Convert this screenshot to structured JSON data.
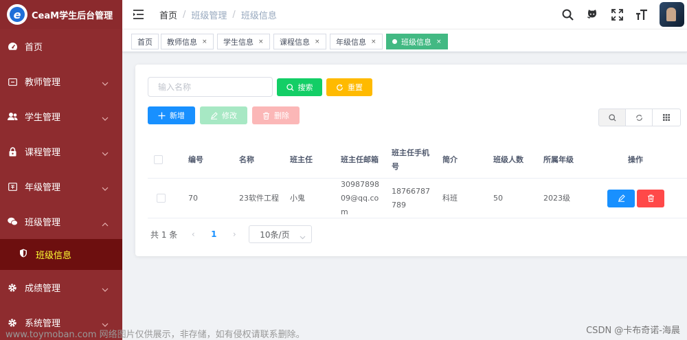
{
  "app": {
    "title": "CeaM学生后台管理",
    "logo_letter": "e"
  },
  "sidebar": {
    "items": [
      {
        "label": "首页",
        "icon": "dashboard-icon"
      },
      {
        "label": "教师管理",
        "icon": "id-card-icon"
      },
      {
        "label": "学生管理",
        "icon": "people-icon"
      },
      {
        "label": "课程管理",
        "icon": "lock-icon"
      },
      {
        "label": "年级管理",
        "icon": "calendar-icon"
      },
      {
        "label": "班级管理",
        "icon": "wechat-icon"
      },
      {
        "label": "成绩管理",
        "icon": "gear-icon"
      },
      {
        "label": "系统管理",
        "icon": "gear-icon"
      }
    ],
    "active_sub": {
      "label": "班级信息",
      "icon": "shield-icon"
    }
  },
  "header": {
    "breadcrumb": [
      "首页",
      "班级管理",
      "班级信息"
    ]
  },
  "tags": [
    {
      "label": "首页"
    },
    {
      "label": "教师信息"
    },
    {
      "label": "学生信息"
    },
    {
      "label": "课程信息"
    },
    {
      "label": "年级信息"
    },
    {
      "label": "班级信息",
      "active": true
    }
  ],
  "search": {
    "placeholder": "输入名称",
    "search_label": "搜索",
    "reset_label": "重置"
  },
  "toolbar": {
    "add_label": "新增",
    "edit_label": "修改",
    "delete_label": "删除"
  },
  "table": {
    "headers": [
      "编号",
      "名称",
      "班主任",
      "班主任邮箱",
      "班主任手机号",
      "简介",
      "班级人数",
      "所属年级",
      "操作"
    ],
    "rows": [
      {
        "id": "70",
        "name": "23软件工程",
        "teacher": "小鬼",
        "email": "3098789809@qq.com",
        "phone": "18766787789",
        "intro": "科班",
        "count": "50",
        "grade": "2023级"
      }
    ]
  },
  "pagination": {
    "total_label": "共 1 条",
    "current_page": "1",
    "page_size": "10条/页"
  },
  "watermark": {
    "left": "www.toymoban.com 网络图片仅供展示，非存储，如有侵权请联系删除。",
    "right": "CSDN @卡布奇诺-海晨"
  },
  "colors": {
    "sidebar": "#8e2c2f",
    "sidebar_active": "#6d0f0f",
    "active_text": "#ffff33",
    "primary": "#1890ff",
    "success": "#13ce66",
    "warning": "#ffba00",
    "danger": "#ff4949",
    "tag_active": "#42b983"
  }
}
